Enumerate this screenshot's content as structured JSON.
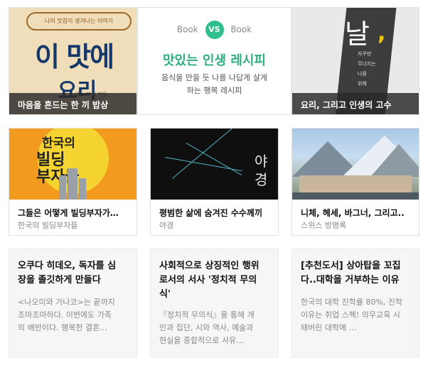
{
  "row1": {
    "card1": {
      "caption": "마음을 흔드는 한 끼 밥상",
      "cover_ribbon": "나의 맛집이 생겨나는 이야기",
      "cover_title_line1": "이 맛에",
      "cover_title_line2": "요리",
      "cover_author": "세트 의 팀 지음"
    },
    "card2": {
      "book_left": "Book",
      "vs": "VS",
      "book_right": "Book",
      "title": "맛있는 인생 레시피",
      "desc_line1": "음식을 만들 듯 나를 나답게 살게",
      "desc_line2": "하는 행복 레시피"
    },
    "card3": {
      "caption": "요리, 그리고 인생의 고수",
      "cover_big": "날",
      "cover_comma": ",",
      "cover_lines": [
        "자꾸만",
        "무너지는",
        "나를",
        "위해"
      ]
    }
  },
  "row2": [
    {
      "title": "그들은 어떻게 빌딩부자가…",
      "subtitle": "한국의 빌딩부자들",
      "thumb_line1": "한국의",
      "thumb_line2": "빌딩",
      "thumb_line3": "부자들"
    },
    {
      "title": "평범한 삶에 숨겨진 수수께끼",
      "subtitle": "야경",
      "thumb_text1": "야",
      "thumb_text2": "경"
    },
    {
      "title": "니체, 헤세, 바그너, 그리고..",
      "subtitle": "스위스 방명록"
    }
  ],
  "row3": [
    {
      "heading_line1": "오쿠다 히데오, 독자를 심",
      "heading_line2": "장을 졸깃하게 만들다",
      "body_line1": "<나오미와 가나코>는 끝까지",
      "body_line2": "조마조마하다. 이번에도 가족",
      "body_line3": "의 배반이다. 행복한 결혼…"
    },
    {
      "heading_line1": "사회적으로 상징적인 행위",
      "heading_line2": "로서의 서사 '정치적 무의",
      "heading_line3": "식'",
      "body_line1": "『정치적 무의식』을 통해 개",
      "body_line2": "인과 집단, 시와 역사, 예술과",
      "body_line3": "현실을 종합적으로 사유…"
    },
    {
      "heading_line1": "[추천도서] 상아탑을 꼬집",
      "heading_line2": "다..대학을 거부하는 이유",
      "body_line1": "한국의 대학 진학률 80%, 진학",
      "body_line2": "이유는 취업 스펙! 의무교육 시",
      "body_line3": "돼버린 대학에 …"
    }
  ],
  "colors": {
    "accent_green": "#2fbf8a",
    "caption_bg": "#282828",
    "card_bg": "#f6f6f6"
  }
}
